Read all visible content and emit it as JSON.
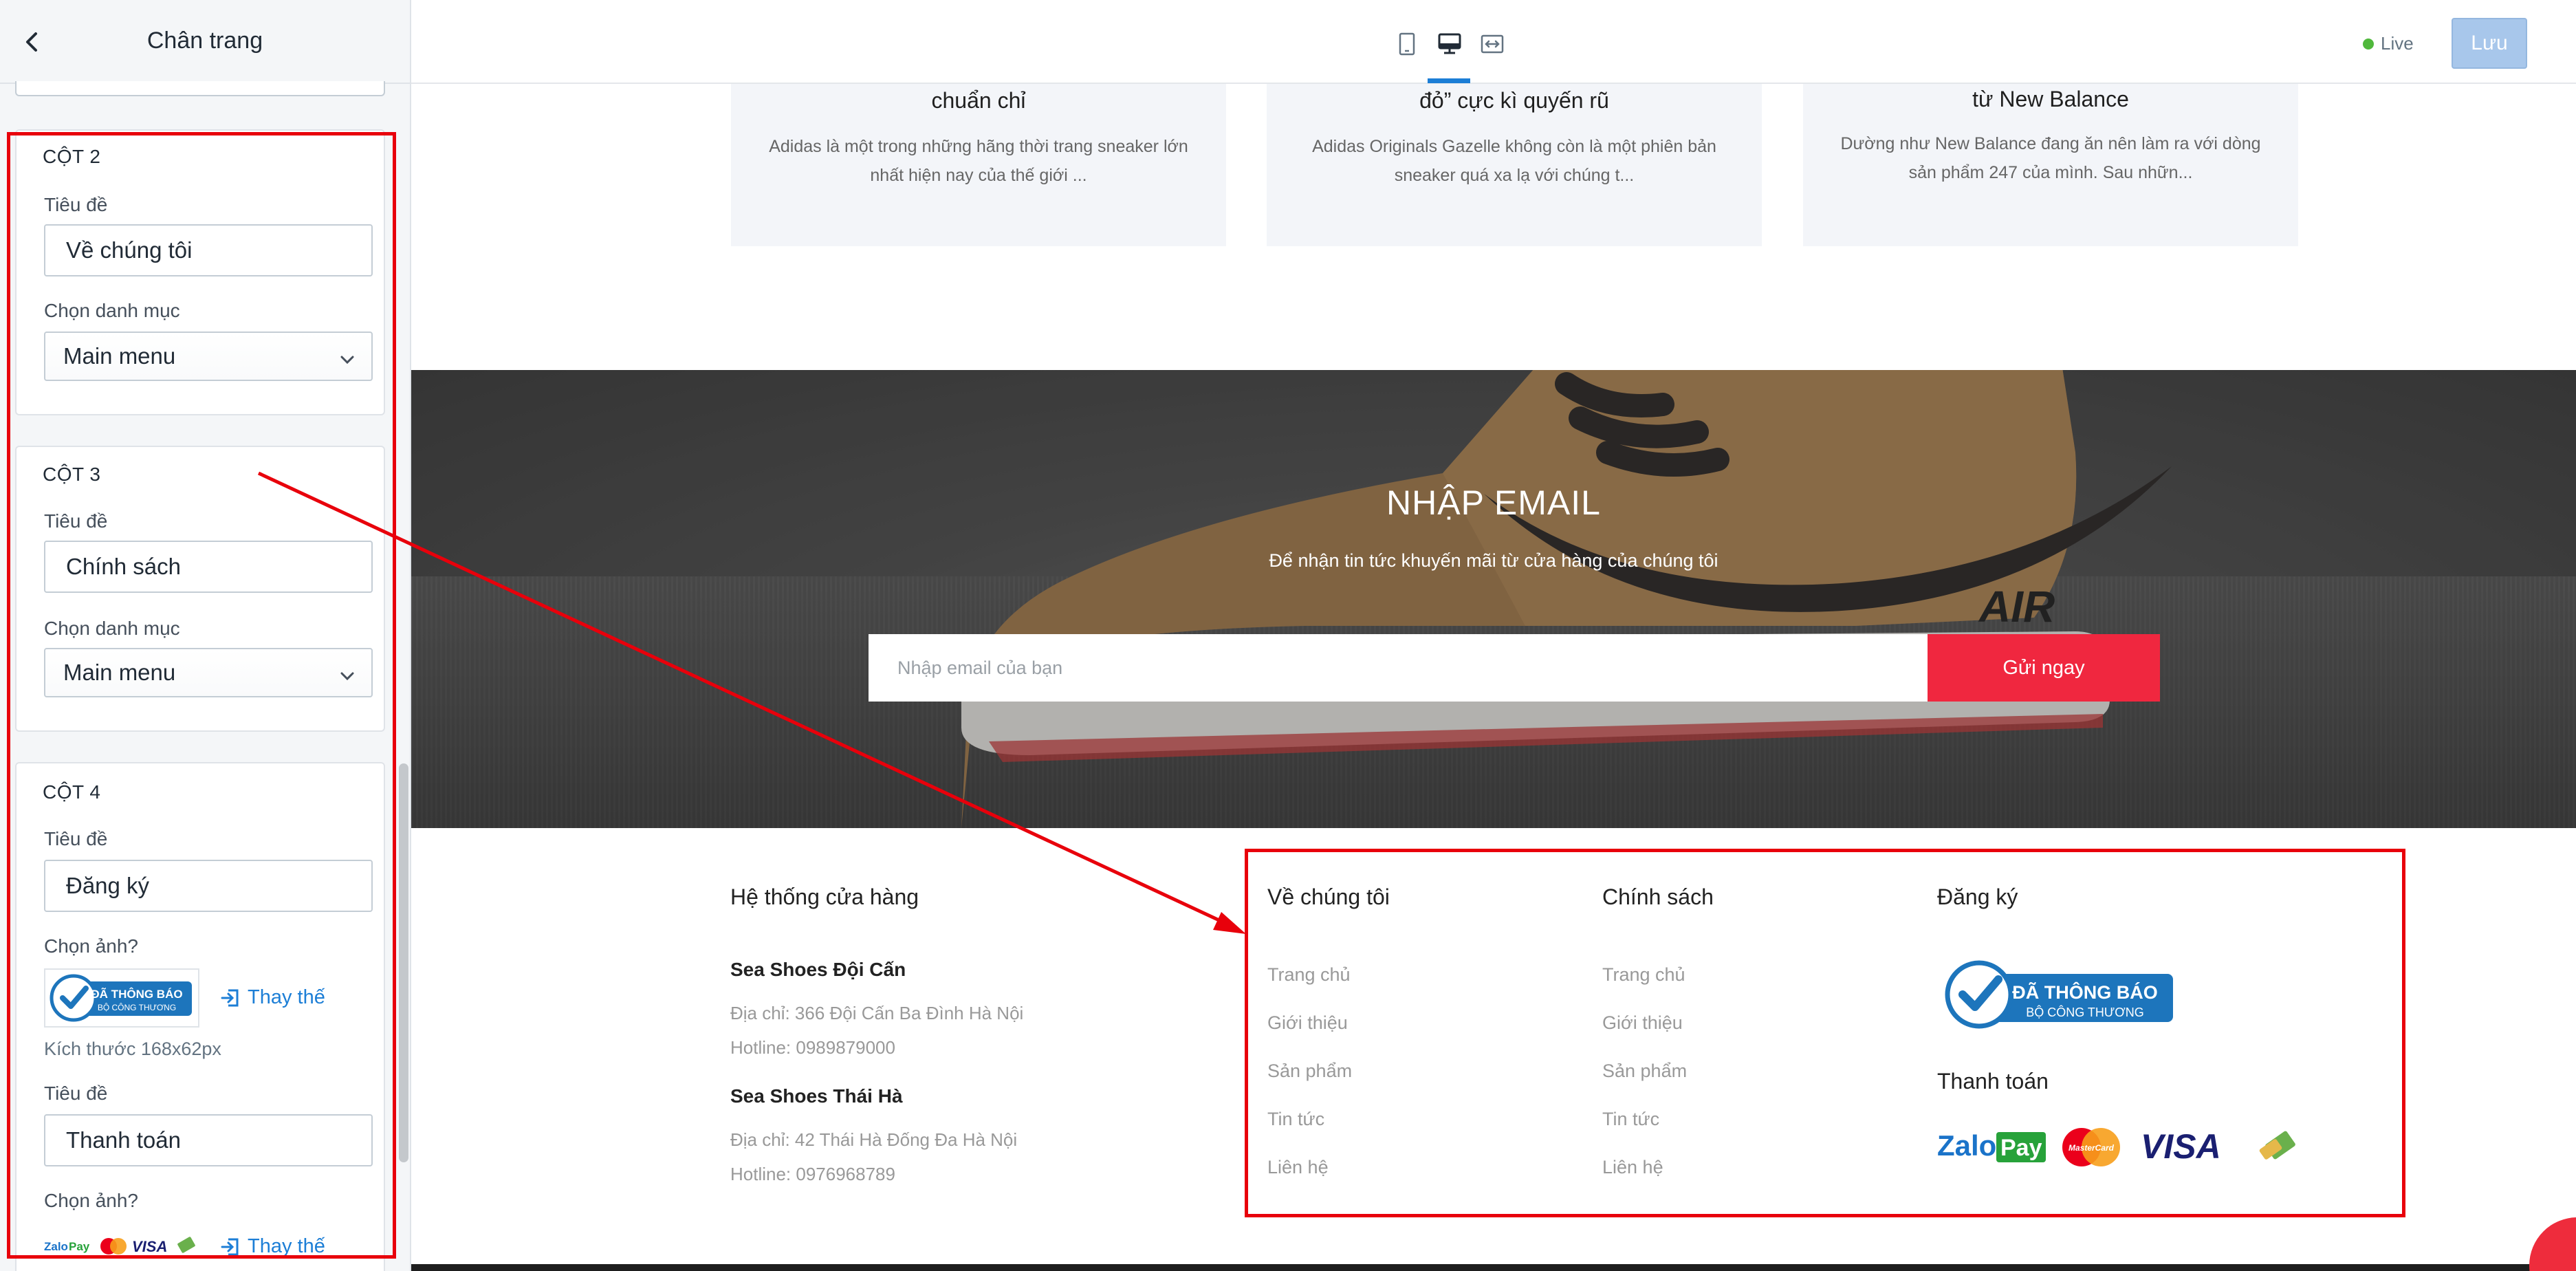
{
  "sidebar": {
    "title": "Chân trang",
    "col2": {
      "heading": "CỘT 2",
      "title_label": "Tiêu đề",
      "title_value": "Về chúng tôi",
      "menu_label": "Chọn danh mục",
      "menu_value": "Main menu"
    },
    "col3": {
      "heading": "CỘT 3",
      "title_label": "Tiêu đề",
      "title_value": "Chính sách",
      "menu_label": "Chọn danh mục",
      "menu_value": "Main menu"
    },
    "col4": {
      "heading": "CỘT 4",
      "title_label": "Tiêu đề",
      "title_value": "Đăng ký",
      "image_label": "Chọn ảnh?",
      "change_label": "Thay thế",
      "size_hint": "Kích thước 168x62px",
      "title2_label": "Tiêu đề",
      "title2_value": "Thanh toán",
      "image2_label": "Chọn ảnh?",
      "change2_label": "Thay thế"
    }
  },
  "topbar": {
    "live_label": "Live",
    "save_label": "Lưu",
    "accent": "#1c7ed6"
  },
  "preview": {
    "blog_posts": [
      {
        "title": "chuẩn chỉ",
        "excerpt": "Adidas là một trong những hãng thời trang sneaker lớn nhất hiện nay của thế giới ..."
      },
      {
        "title": "đỏ” cực kì quyến rũ",
        "excerpt": "Adidas Originals Gazelle không còn là một phiên bản sneaker quá xa lạ với chúng t..."
      },
      {
        "title": "từ New Balance",
        "excerpt": "Dường như New Balance đang ăn nên làm ra với dòng sản phẩm 247 của mình. Sau nhữn..."
      }
    ],
    "newsletter": {
      "title": "NHẬP EMAIL",
      "subtitle": "Để nhận tin tức khuyến mãi từ cửa hàng của chúng tôi",
      "placeholder": "Nhập email của bạn",
      "button": "Gửi ngay",
      "button_color": "#f0273f"
    },
    "footer": {
      "stores_heading": "Hệ thống cửa hàng",
      "stores": [
        {
          "name": "Sea Shoes Đội Cấn",
          "address": "Địa chỉ: 366 Đội Cấn Ba Đình Hà Nội",
          "hotline": "Hotline: 0989879000"
        },
        {
          "name": "Sea Shoes Thái Hà",
          "address": "Địa chỉ: 42 Thái Hà Đống Đa Hà Nội",
          "hotline": "Hotline: 0976968789"
        }
      ],
      "about_heading": "Về chúng tôi",
      "about_links": [
        "Trang chủ",
        "Giới thiệu",
        "Sản phẩm",
        "Tin tức",
        "Liên hệ"
      ],
      "policy_heading": "Chính sách",
      "policy_links": [
        "Trang chủ",
        "Giới thiệu",
        "Sản phẩm",
        "Tin tức",
        "Liên hệ"
      ],
      "register_heading": "Đăng ký",
      "badge_line1": "ĐÃ THÔNG BÁO",
      "badge_line2": "BỘ CÔNG THƯƠNG",
      "payment_heading": "Thanh toán",
      "payment_logos": [
        "ZaloPay",
        "MasterCard",
        "VISA"
      ]
    }
  }
}
